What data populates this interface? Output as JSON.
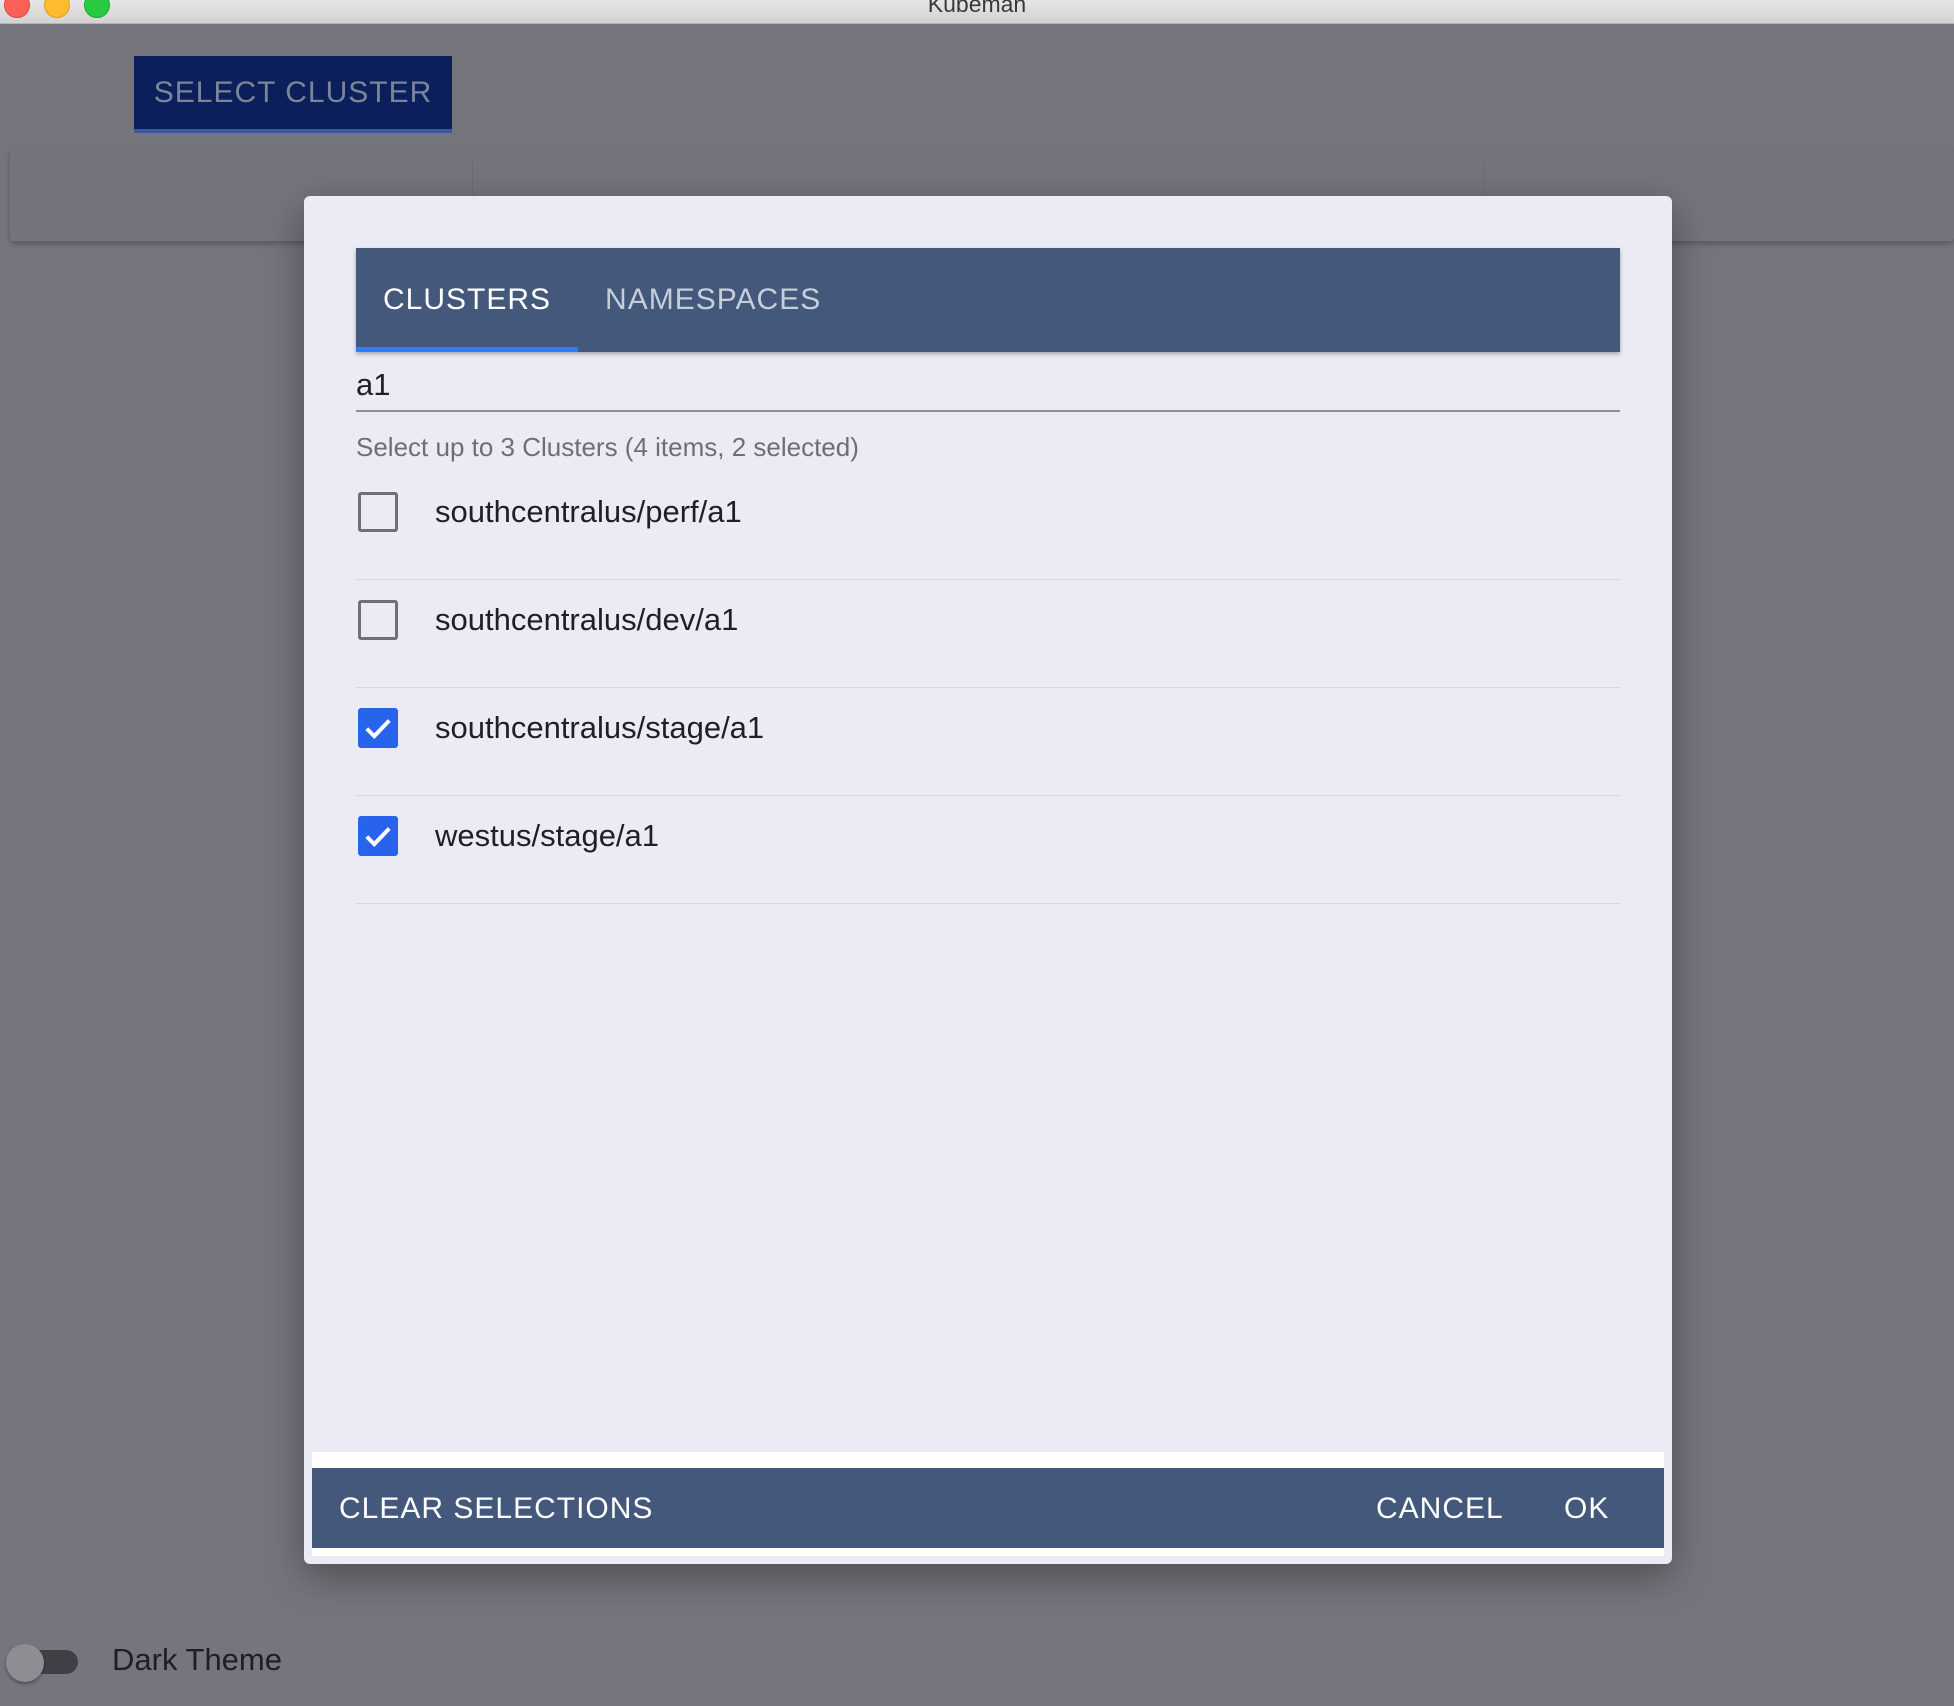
{
  "window": {
    "title": "Kubeman"
  },
  "backdrop": {
    "select_cluster_label": "SELECT CLUSTER",
    "dark_theme_label": "Dark Theme"
  },
  "dialog": {
    "tabs": [
      {
        "label": "CLUSTERS",
        "active": true
      },
      {
        "label": "NAMESPACES",
        "active": false
      }
    ],
    "filter_value": "a1",
    "helper_text": "Select up to 3 Clusters (4 items, 2 selected)",
    "items": [
      {
        "label": "southcentralus/perf/a1",
        "checked": false
      },
      {
        "label": "southcentralus/dev/a1",
        "checked": false
      },
      {
        "label": "southcentralus/stage/a1",
        "checked": true
      },
      {
        "label": "westus/stage/a1",
        "checked": true
      }
    ],
    "footer": {
      "clear_label": "CLEAR SELECTIONS",
      "cancel_label": "CANCEL",
      "ok_label": "OK"
    }
  },
  "colors": {
    "accent": "#2863ec",
    "header_bar": "#43587a",
    "dialog_bg": "#ebebf6"
  }
}
